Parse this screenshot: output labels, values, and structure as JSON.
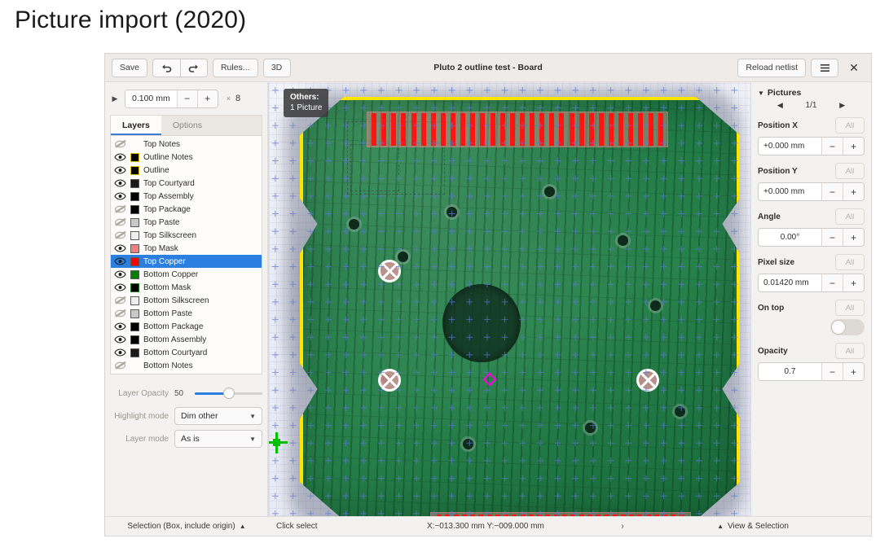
{
  "slide": {
    "title": "Picture import (2020)"
  },
  "window": {
    "title": "Pluto 2 outline test - Board",
    "toolbar": {
      "save": "Save",
      "undo_icon": "undo-icon",
      "redo_icon": "redo-icon",
      "rules": "Rules...",
      "three_d": "3D",
      "reload_netlist": "Reload netlist",
      "menu_icon": "hamburger-menu-icon",
      "close_icon": "close-icon"
    }
  },
  "left_panel": {
    "grid": {
      "expander_icon": "chevron-right-icon",
      "value": "0.100 mm",
      "minus": "−",
      "plus": "+",
      "multiplier_symbol": "×",
      "multiplier_value": "8"
    },
    "tabs": [
      {
        "label": "Layers",
        "active": true
      },
      {
        "label": "Options",
        "active": false
      }
    ],
    "layers": [
      {
        "name": "Top Notes",
        "visible": false,
        "swatch": "none",
        "selected": false
      },
      {
        "name": "Outline Notes",
        "visible": true,
        "swatch": "#000000",
        "border": "#e0c000",
        "selected": false
      },
      {
        "name": "Outline",
        "visible": true,
        "swatch": "#000000",
        "border": "#e0c000",
        "selected": false
      },
      {
        "name": "Top Courtyard",
        "visible": true,
        "swatch": "#1a1a1a",
        "selected": false
      },
      {
        "name": "Top Assembly",
        "visible": true,
        "swatch": "#000000",
        "selected": false
      },
      {
        "name": "Top Package",
        "visible": false,
        "swatch": "#000000",
        "selected": false
      },
      {
        "name": "Top Paste",
        "visible": false,
        "swatch": "#c8c8c8",
        "selected": false
      },
      {
        "name": "Top Silkscreen",
        "visible": false,
        "swatch": "#efefef",
        "selected": false
      },
      {
        "name": "Top Mask",
        "visible": true,
        "swatch": "#f08080",
        "selected": false
      },
      {
        "name": "Top Copper",
        "visible": true,
        "swatch": "#ff0000",
        "selected": true
      },
      {
        "name": "Bottom Copper",
        "visible": true,
        "swatch": "#008000",
        "selected": false
      },
      {
        "name": "Bottom Mask",
        "visible": true,
        "swatch": "#000000",
        "border": "#1e7a1e",
        "selected": false
      },
      {
        "name": "Bottom Silkscreen",
        "visible": false,
        "swatch": "#efefef",
        "selected": false
      },
      {
        "name": "Bottom Paste",
        "visible": false,
        "swatch": "#c8c8c8",
        "selected": false
      },
      {
        "name": "Bottom Package",
        "visible": true,
        "swatch": "#000000",
        "selected": false
      },
      {
        "name": "Bottom Assembly",
        "visible": true,
        "swatch": "#000000",
        "selected": false
      },
      {
        "name": "Bottom Courtyard",
        "visible": true,
        "swatch": "#1a1a1a",
        "selected": false
      },
      {
        "name": "Bottom Notes",
        "visible": false,
        "swatch": "none",
        "selected": false
      }
    ],
    "controls": {
      "opacity_label": "Layer Opacity",
      "opacity_value": "50",
      "highlight_label": "Highlight mode",
      "highlight_value": "Dim other",
      "layer_mode_label": "Layer mode",
      "layer_mode_value": "As is"
    }
  },
  "canvas": {
    "others_badge_title": "Others:",
    "others_badge_value": "1 Picture",
    "origin_marker": "origin-crosshair",
    "anchor_marker": "picture-anchor"
  },
  "right_panel": {
    "section_title": "Pictures",
    "collapse_icon": "triangle-down-icon",
    "pager": {
      "prev_icon": "prev-arrow-icon",
      "label": "1/1",
      "next_icon": "next-arrow-icon"
    },
    "all_label": "All",
    "minus": "−",
    "plus": "+",
    "fields": [
      {
        "label": "Position X",
        "value": "+0.000 mm",
        "type": "spin"
      },
      {
        "label": "Position Y",
        "value": "+0.000 mm",
        "type": "spin"
      },
      {
        "label": "Angle",
        "value": "0.00°",
        "type": "spin"
      },
      {
        "label": "Pixel size",
        "value": "0.01420 mm",
        "type": "spin"
      },
      {
        "label": "On top",
        "value": "off",
        "type": "toggle"
      },
      {
        "label": "Opacity",
        "value": "0.7",
        "type": "spin"
      }
    ]
  },
  "statusbar": {
    "selection": "Selection (Box, include origin)",
    "selection_tri": "▲",
    "click_select": "Click select",
    "coords": "X:−013.300 mm Y:−009.000 mm",
    "chevron": "›",
    "view_tri": "▲",
    "view": "View & Selection"
  },
  "colors": {
    "accent": "#2a7fe0",
    "copper_top": "#ff0000",
    "copper_bottom": "#008000",
    "outline": "#ffe400",
    "anchor": "#ff00e0",
    "origin": "#00c000",
    "mask": "#f08080"
  }
}
